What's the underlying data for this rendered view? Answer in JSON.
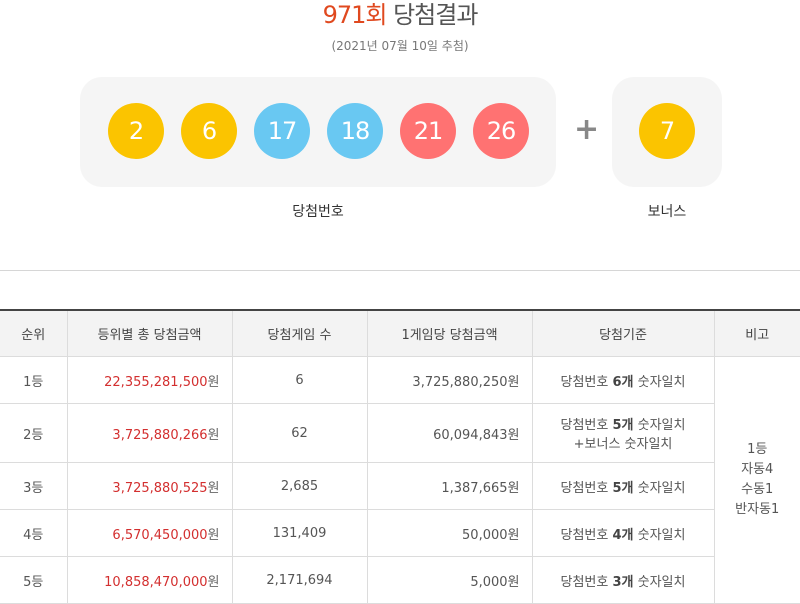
{
  "header": {
    "round": "971회",
    "title": "당첨결과",
    "date": "(2021년 07월 10일 추첨)"
  },
  "winning_numbers": [
    {
      "number": "2",
      "color": "#fbc400"
    },
    {
      "number": "6",
      "color": "#fbc400"
    },
    {
      "number": "17",
      "color": "#69c8f2"
    },
    {
      "number": "18",
      "color": "#69c8f2"
    },
    {
      "number": "21",
      "color": "#ff7272"
    },
    {
      "number": "26",
      "color": "#ff7272"
    }
  ],
  "plus_sign": "+",
  "bonus": {
    "number": "7",
    "color": "#fbc400"
  },
  "labels": {
    "winning": "당첨번호",
    "bonus": "보너스"
  },
  "table": {
    "headers": [
      "순위",
      "등위별 총 당첨금액",
      "당첨게임 수",
      "1게임당 당첨금액",
      "당첨기준",
      "비고"
    ],
    "rows": [
      {
        "rank": "1등",
        "total": "22,355,281,500",
        "games": "6",
        "per_game": "3,725,880,250",
        "crit_pre": "당첨번호 ",
        "crit_bold": "6개",
        "crit_post": " 숫자일치",
        "crit_extra": ""
      },
      {
        "rank": "2등",
        "total": "3,725,880,266",
        "games": "62",
        "per_game": "60,094,843",
        "crit_pre": "당첨번호 ",
        "crit_bold": "5개",
        "crit_post": " 숫자일치",
        "crit_extra": "+보너스 숫자일치"
      },
      {
        "rank": "3등",
        "total": "3,725,880,525",
        "games": "2,685",
        "per_game": "1,387,665",
        "crit_pre": "당첨번호 ",
        "crit_bold": "5개",
        "crit_post": " 숫자일치",
        "crit_extra": ""
      },
      {
        "rank": "4등",
        "total": "6,570,450,000",
        "games": "131,409",
        "per_game": "50,000",
        "crit_pre": "당첨번호 ",
        "crit_bold": "4개",
        "crit_post": " 숫자일치",
        "crit_extra": ""
      },
      {
        "rank": "5등",
        "total": "10,858,470,000",
        "games": "2,171,694",
        "per_game": "5,000",
        "crit_pre": "당첨번호 ",
        "crit_bold": "3개",
        "crit_post": " 숫자일치",
        "crit_extra": ""
      }
    ],
    "currency": "원",
    "note": [
      "1등",
      "자동4",
      "수동1",
      "반자동1"
    ]
  }
}
